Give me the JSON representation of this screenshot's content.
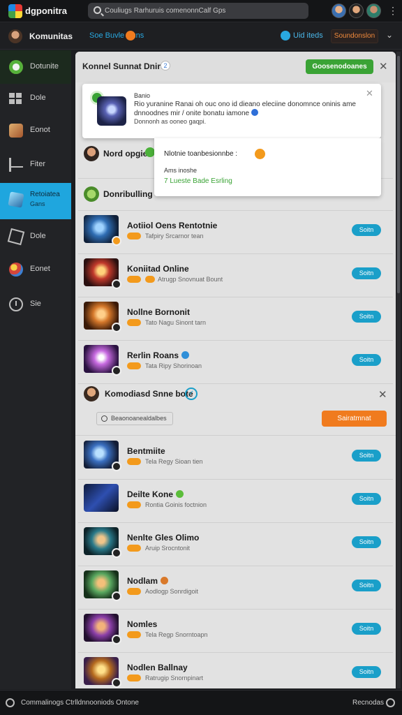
{
  "topbar": {
    "brand": "dgponitra",
    "search_placeholder": "Couliugs Rarhuruis comenonnCalf Gps",
    "menu_glyph": "⋮"
  },
  "subbar": {
    "title": "Komunitas",
    "tag": "Soe Buvle Suns",
    "link_text": "Uid iteds",
    "button_label": "Soundonslon",
    "chevron": "⌄"
  },
  "sidebar": {
    "items": [
      {
        "label": "Dotunite"
      },
      {
        "label": "Dole"
      },
      {
        "label": "Eonot"
      },
      {
        "label": "Fiter"
      },
      {
        "label": "Retoiatea",
        "sublabel": "Gans"
      },
      {
        "label": "Dole"
      },
      {
        "label": "Eonet"
      },
      {
        "label": "Sie"
      }
    ]
  },
  "panel": {
    "title": "Konnel Sunnat Dnire",
    "title_badge": "2",
    "green_button": "Goosenodoanes",
    "close": "✕"
  },
  "popup1": {
    "label": "Banio",
    "text": "Rio  yuranine Ranai oh ouc ono id dieano eleciine donomnce oninis ame dnnoodnes mir / onite bonatu iamone",
    "sub": "Donnonh as ooneo gaqpi."
  },
  "popup2": {
    "title": "Nlotnie toanbesionnbe :",
    "sub": "Ams inoshe",
    "link": "7 Lueste Bade Esrling"
  },
  "simple_rows": [
    {
      "title": "Nord opgie"
    },
    {
      "title": "Donribulling"
    }
  ],
  "rows_top": [
    {
      "title": "Aotiiol Oens Rentotnie",
      "meta": "Tafpiry Srcarnor tean",
      "play": "Soitn"
    },
    {
      "title": "Koniitad Online",
      "meta": "Atrugp Snovnuat Bount",
      "play": "Soitn"
    },
    {
      "title": "Nollne Bornonit",
      "meta": "Tato Nagu Sinont tarn",
      "play": "Soitn"
    },
    {
      "title": "Rerlin Roans",
      "meta": "Tata Ripy Shorinoan",
      "play": "Soitn"
    }
  ],
  "section2": {
    "title": "Komodiasd Snne bote",
    "tag": "Beaonoanealdalbes",
    "button": "Sairatmnat",
    "close": "✕"
  },
  "rows_bottom": [
    {
      "title": "Bentmiite",
      "meta": "Tela Regy Sioan tien",
      "play": "Soitn"
    },
    {
      "title": "Deilte Kone",
      "meta": "Rontia Goinis foctnion",
      "play": "Soitn"
    },
    {
      "title": "Nenlte Gles Olimo",
      "meta": "Aruip Srocntonit",
      "play": "Soitn"
    },
    {
      "title": "Nodlam",
      "meta": "Aodlogp Sonrdigoit",
      "play": "Soitn"
    },
    {
      "title": "Nomles",
      "meta": "Tela Regp Snorntoapn",
      "play": "Soitn"
    },
    {
      "title": "Nodlen Ballnay",
      "meta": "Ratrugip Snornpinart",
      "play": "Soitn"
    }
  ],
  "bottombar": {
    "left": "Commalinogs Ctrlldnnooniods Ontone",
    "right": "Recnodas"
  },
  "colors": {
    "accent_blue": "#1fa6de",
    "accent_green": "#3aa335",
    "accent_orange": "#f07b1e"
  }
}
